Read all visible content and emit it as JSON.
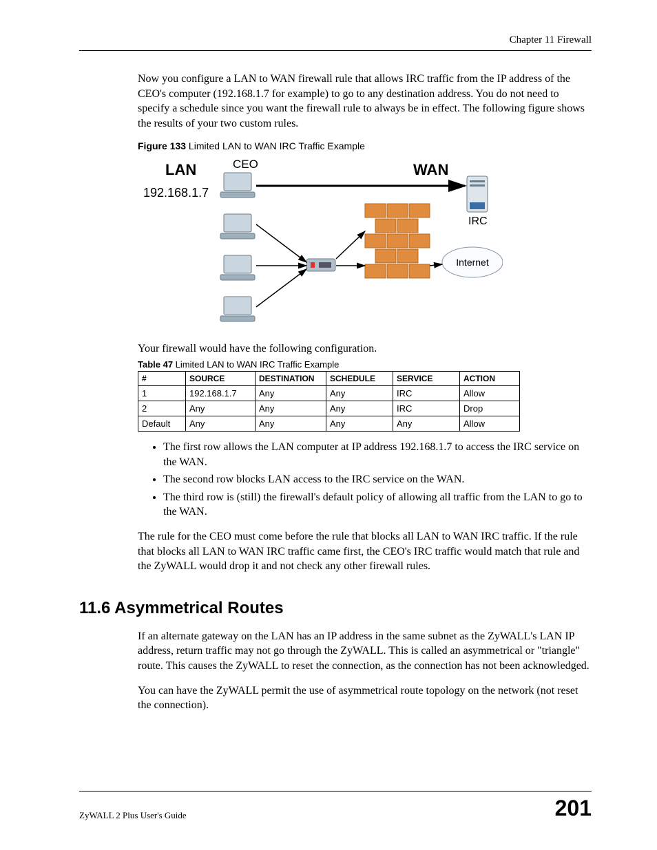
{
  "header": {
    "chapter": "Chapter 11 Firewall"
  },
  "para1": "Now you configure a LAN to WAN firewall rule that allows IRC traffic from the IP address of the CEO's computer (192.168.1.7 for example) to go to any destination address. You do not need to specify a schedule since you want the firewall rule to always be in effect. The following figure shows the results of your two custom rules.",
  "fig_label": "Figure 133",
  "fig_title": "   Limited LAN to WAN IRC Traffic Example",
  "diagram": {
    "lan_label": "LAN",
    "lan_ip": "192.168.1.7",
    "ceo_label": "CEO",
    "wan_label": "WAN",
    "irc_label": "IRC",
    "internet_label": "Internet"
  },
  "para2": "Your firewall would have the following configuration.",
  "tbl_label": "Table 47",
  "tbl_title": "   Limited LAN to WAN IRC Traffic Example",
  "table": {
    "headers": [
      "#",
      "SOURCE",
      "DESTINATION",
      "SCHEDULE",
      "SERVICE",
      "ACTION"
    ],
    "rows": [
      [
        "1",
        "192.168.1.7",
        "Any",
        "Any",
        "IRC",
        "Allow"
      ],
      [
        "2",
        "Any",
        "Any",
        "Any",
        "IRC",
        "Drop"
      ],
      [
        "Default",
        "Any",
        "Any",
        "Any",
        "Any",
        "Allow"
      ]
    ]
  },
  "bullets": [
    "The first row allows the LAN computer at IP address 192.168.1.7 to access the IRC service on the WAN.",
    "The second row blocks LAN access to the IRC service on the WAN.",
    "The third row is (still) the firewall's default policy of allowing all traffic from the LAN to go to the WAN."
  ],
  "para3": "The rule for the CEO must come before the rule that blocks all LAN to WAN IRC traffic. If the rule that blocks all LAN to WAN IRC traffic came first, the CEO's IRC traffic would match that rule and the ZyWALL would drop it and not check any other firewall rules.",
  "section_heading": "11.6  Asymmetrical Routes",
  "para4": "If an alternate gateway on the LAN has an IP address in the same subnet as the ZyWALL's LAN IP address, return traffic may not go through the ZyWALL. This is called an asymmetrical or \"triangle\" route. This causes the ZyWALL to reset the connection, as the connection has not been acknowledged.",
  "para5": "You can have the ZyWALL permit the use of asymmetrical route topology on the network (not reset the connection).",
  "footer": {
    "guide": "ZyWALL 2 Plus User's Guide",
    "page": "201"
  }
}
